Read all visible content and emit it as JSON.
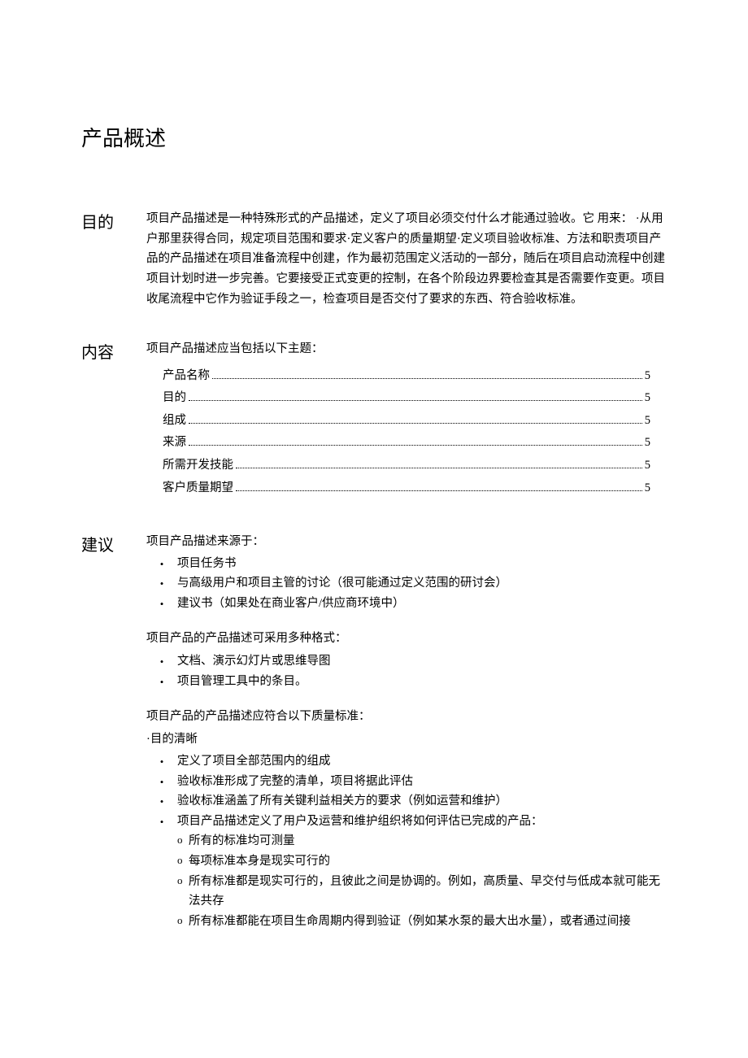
{
  "title": "产品概述",
  "sections": {
    "purpose": {
      "label": "目的",
      "body": "项目产品描述是一种特殊形式的产品描述，定义了项目必须交付什么才能通过验收。它 用来： ·从用户那里获得合同，规定项目范围和要求·定义客户的质量期望·定义项目验收标准、方法和职责项目产品的产品描述在项目准备流程中创建，作为最初范围定义活动的一部分，随后在项目启动流程中创建项目计划时进一步完善。它要接受正式变更的控制，在各个阶段边界要检查其是否需要作变更。项目收尾流程中它作为验证手段之一，检查项目是否交付了要求的东西、符合验收标准。"
    },
    "content": {
      "label": "内容",
      "intro": "项目产品描述应当包括以下主题：",
      "toc": [
        {
          "label": "产品名称",
          "page": "5"
        },
        {
          "label": "目的",
          "page": "5"
        },
        {
          "label": "组成",
          "page": "5"
        },
        {
          "label": "来源",
          "page": "5"
        },
        {
          "label": "所需开发技能",
          "page": "5"
        },
        {
          "label": "客户质量期望",
          "page": "5"
        }
      ]
    },
    "advice": {
      "label": "建议",
      "sources_intro": "项目产品描述来源于：",
      "sources": [
        "项目任务书",
        "与高级用户和项目主管的讨论（很可能通过定义范围的研讨会）",
        "建议书（如果处在商业客户/供应商环境中）"
      ],
      "formats_intro": "项目产品的产品描述可采用多种格式：",
      "formats": [
        "文档、演示幻灯片或思维导图",
        "项目管理工具中的条目。"
      ],
      "quality_intro": "项目产品的产品描述应符合以下质量标准：",
      "quality_lead": "·目的清晰",
      "quality": [
        "定义了项目全部范围内的组成",
        "验收标准形成了完整的清单，项目将据此评估",
        "验收标准涵盖了所有关键利益相关方的要求（例如运营和维护）",
        "项目产品描述定义了用户及运营和维护组织将如何评估已完成的产品："
      ],
      "quality_sub": [
        "所有的标准均可测量",
        "每项标准本身是现实可行的",
        "所有标准都是现实可行的，且彼此之间是协调的。例如，高质量、早交付与低成本就可能无法共存",
        "所有标准都能在项目生命周期内得到验证（例如某水泵的最大出水量），或者通过间接"
      ]
    }
  }
}
